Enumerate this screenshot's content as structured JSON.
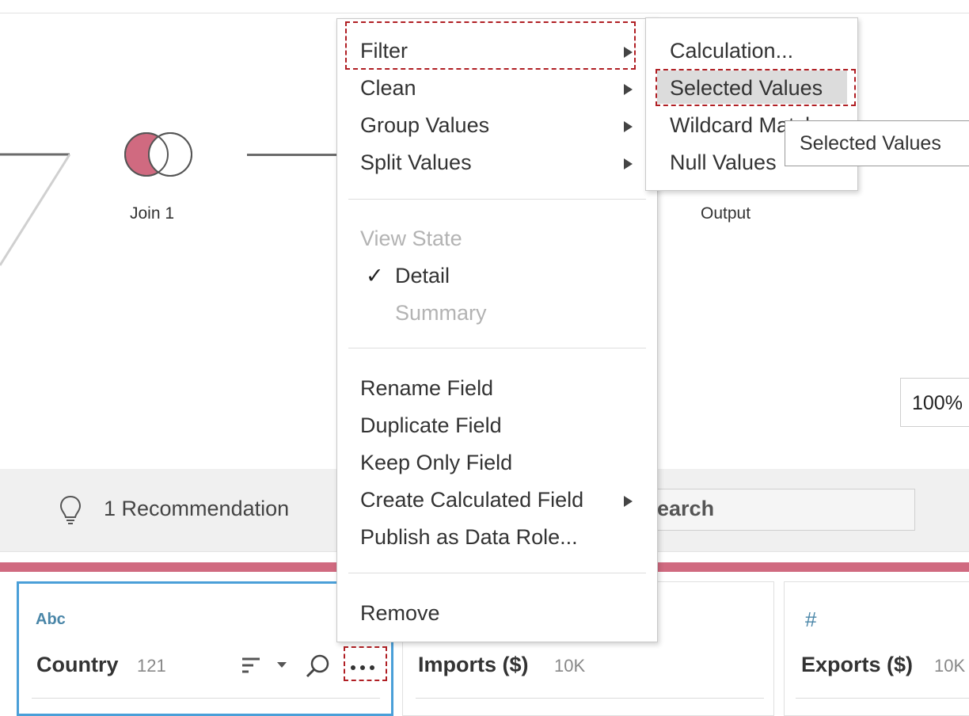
{
  "flow": {
    "join_label": "Join 1",
    "output_label": "Output"
  },
  "zoom": {
    "value": "100%"
  },
  "recommendations": {
    "label": "1 Recommendation",
    "search_placeholder": "Search"
  },
  "cards": [
    {
      "type": "Abc",
      "title": "Country",
      "count": "121"
    },
    {
      "type": "",
      "title": "Imports ($)",
      "count": "10K"
    },
    {
      "type": "#",
      "title": "Exports ($)",
      "count": "10K"
    }
  ],
  "context_menu": {
    "items": {
      "filter": "Filter",
      "clean": "Clean",
      "group_values": "Group Values",
      "split_values": "Split Values",
      "view_state": "View State",
      "detail": "Detail",
      "summary": "Summary",
      "rename_field": "Rename Field",
      "duplicate_field": "Duplicate Field",
      "keep_only_field": "Keep Only Field",
      "create_calculated_field": "Create Calculated Field",
      "publish_as_data_role": "Publish as Data Role...",
      "remove": "Remove"
    },
    "check_mark": "✓"
  },
  "filter_submenu": {
    "items": {
      "calculation": "Calculation...",
      "selected_values": "Selected Values",
      "wildcard_match": "Wildcard Match",
      "null_values": "Null Values"
    }
  },
  "tooltip": {
    "text": "Selected Values"
  },
  "colors": {
    "accent_pink": "#d06a80",
    "selection_blue": "#4a9fd8",
    "highlight_red": "#b01f24"
  }
}
